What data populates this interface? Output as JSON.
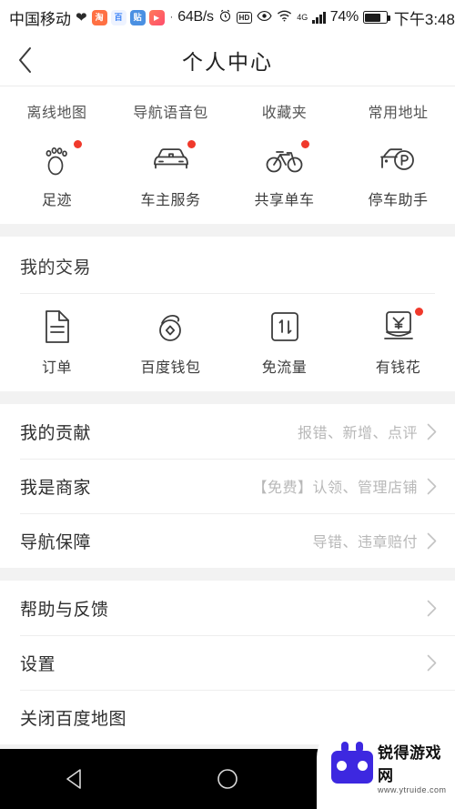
{
  "statusbar": {
    "carrier": "中国移动",
    "app_icons": [
      "heart-icon",
      "taobao-icon",
      "baidu-icon",
      "tieba-icon",
      "video-icon"
    ],
    "separator_dot": "·",
    "network_speed": "64B/s",
    "alarm_icon": "alarm-icon",
    "hd_badge": "HD",
    "eye_icon": "eye-icon",
    "wifi_icon": "wifi-icon",
    "network_type": "4G",
    "signal_icon": "signal-bars-icon",
    "battery_percent": "74%",
    "battery_level": 74,
    "time": "下午3:48"
  },
  "titlebar": {
    "back_icon": "back-chevron-icon",
    "title": "个人中心"
  },
  "top_row": {
    "items": [
      {
        "label": "离线地图"
      },
      {
        "label": "导航语音包"
      },
      {
        "label": "收藏夹"
      },
      {
        "label": "常用地址"
      }
    ]
  },
  "tools_row": {
    "items": [
      {
        "label": "足迹",
        "icon": "footprint-icon",
        "badge": true
      },
      {
        "label": "车主服务",
        "icon": "car-icon",
        "badge": true
      },
      {
        "label": "共享单车",
        "icon": "bicycle-icon",
        "badge": true
      },
      {
        "label": "停车助手",
        "icon": "car-parking-icon",
        "badge": false
      }
    ]
  },
  "transactions": {
    "title": "我的交易",
    "items": [
      {
        "label": "订单",
        "icon": "document-icon",
        "badge": false
      },
      {
        "label": "百度钱包",
        "icon": "wallet-coin-icon",
        "badge": false
      },
      {
        "label": "免流量",
        "icon": "data-free-icon",
        "badge": false
      },
      {
        "label": "有钱花",
        "icon": "money-bag-icon",
        "badge": true
      }
    ]
  },
  "menu_group_1": {
    "rows": [
      {
        "label": "我的贡献",
        "sub": "报错、新增、点评",
        "chevron": "chevron-right-icon"
      },
      {
        "label": "我是商家",
        "sub": "【免费】认领、管理店铺",
        "chevron": "chevron-right-icon"
      },
      {
        "label": "导航保障",
        "sub": "导错、违章赔付",
        "chevron": "chevron-right-icon"
      }
    ]
  },
  "menu_group_2": {
    "rows": [
      {
        "label": "帮助与反馈",
        "sub": "",
        "chevron": "chevron-right-icon"
      },
      {
        "label": "设置",
        "sub": "",
        "chevron": "chevron-right-icon"
      },
      {
        "label": "关闭百度地图",
        "sub": "",
        "chevron": "chevron-right-icon"
      }
    ]
  },
  "navbar": {
    "back": "android-back-icon",
    "home": "android-home-icon",
    "recents": "android-recents-icon"
  },
  "watermark": {
    "title": "锐得游戏网",
    "url": "www.ytruide.com"
  },
  "colors": {
    "badge_red": "#f0392b",
    "page_bg": "#f2f2f2",
    "card_bg": "#ffffff",
    "text_primary": "#2e2e2e",
    "text_secondary": "#b8b8b8"
  }
}
